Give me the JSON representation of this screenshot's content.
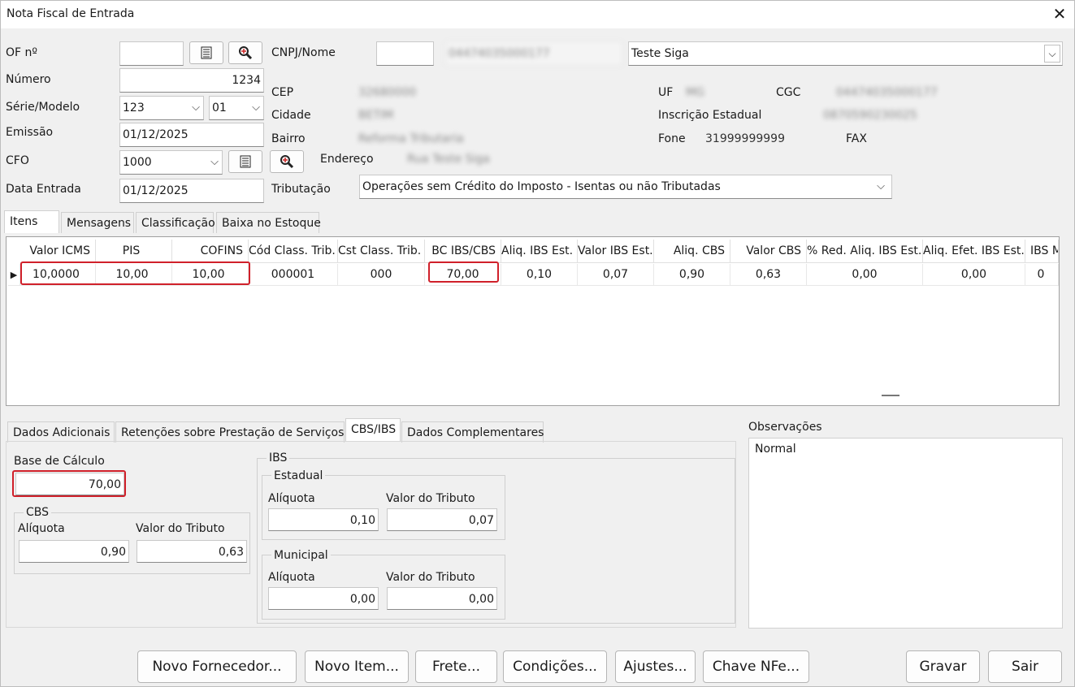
{
  "window": {
    "title": "Nota Fiscal de Entrada",
    "close_glyph": "✕"
  },
  "form": {
    "of_label": "OF nº",
    "of_value": "",
    "numero_label": "Número",
    "numero_value": "1234",
    "serie_label": "Série/Modelo",
    "serie_value": "123",
    "modelo_value": "01",
    "emissao_label": "Emissão",
    "emissao_value": "01/12/2025",
    "cfo_label": "CFO",
    "cfo_value": "1000",
    "entrada_label": "Data Entrada",
    "entrada_value": "01/12/2025",
    "cnpj_label": "CNPJ/Nome",
    "cnpj_code": "",
    "cnpj_value": "04474035000177",
    "nome_value": "Teste Siga",
    "cep_label": "CEP",
    "cep_value": "32680000",
    "cidade_label": "Cidade",
    "cidade_value": "BETIM",
    "bairro_label": "Bairro",
    "bairro_value": "Reforma Tributaria",
    "endereco_label": "Endereço",
    "endereco_value": "Rua Teste Siga",
    "uf_label": "UF",
    "uf_value": "MG",
    "cgc_label": "CGC",
    "cgc_value": "04474035000177",
    "ie_label": "Inscrição Estadual",
    "ie_value": "0870590230025",
    "fone_label": "Fone",
    "fone_value": "31999999999",
    "fax_label": "FAX",
    "tributacao_label": "Tributação",
    "tributacao_value": "Operações sem Crédito do Imposto - Isentas ou não Tributadas"
  },
  "top_tabs": [
    "Itens",
    "Mensagens",
    "Classificação",
    "Baixa no Estoque"
  ],
  "grid": {
    "headers": [
      "Valor ICMS",
      "PIS",
      "COFINS",
      "Cód Class. Trib.",
      "Cst Class. Trib.",
      "BC IBS/CBS",
      "Aliq. IBS Est.",
      "Valor IBS Est.",
      "Aliq. CBS",
      "Valor CBS",
      "% Red. Aliq. IBS Est.",
      "Aliq. Efet. IBS Est.",
      "IBS M"
    ],
    "row": [
      "10,0000",
      "10,00",
      "10,00",
      "000001",
      "000",
      "70,00",
      "0,10",
      "0,07",
      "0,90",
      "0,63",
      "0,00",
      "0,00",
      "0"
    ],
    "row_marker": "▶"
  },
  "bottom_tabs": [
    "Dados Adicionais",
    "Retenções sobre Prestação de Serviços",
    "CBS/IBS",
    "Dados Complementares"
  ],
  "cbsibs": {
    "base_label": "Base de Cálculo",
    "base_value": "70,00",
    "cbs_title": "CBS",
    "cbs_aliquota_label": "Alíquota",
    "cbs_valor_label": "Valor do Tributo",
    "cbs_aliquota": "0,90",
    "cbs_valor": "0,63",
    "ibs_title": "IBS",
    "estadual_title": "Estadual",
    "est_aliquota_label": "Alíquota",
    "est_valor_label": "Valor do Tributo",
    "est_aliquota": "0,10",
    "est_valor": "0,07",
    "municipal_title": "Municipal",
    "mun_aliquota_label": "Alíquota",
    "mun_valor_label": "Valor do Tributo",
    "mun_aliquota": "0,00",
    "mun_valor": "0,00"
  },
  "observacoes": {
    "label": "Observações",
    "value": "Normal"
  },
  "buttons": {
    "novo_fornecedor": "Novo Fornecedor...",
    "novo_item": "Novo Item...",
    "frete": "Frete...",
    "condicoes": "Condições...",
    "ajustes": "Ajustes...",
    "chave_nfe": "Chave NFe...",
    "gravar": "Gravar",
    "sair": "Sair"
  },
  "icons": {
    "list": "list-icon",
    "zoom": "magnifier-icon",
    "dropdown": "chevron-down-icon"
  }
}
